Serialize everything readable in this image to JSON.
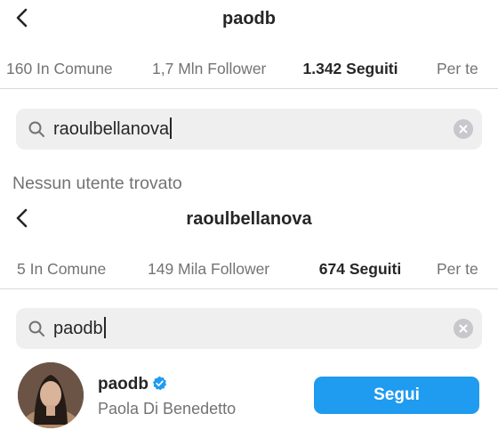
{
  "screen1": {
    "header": {
      "title": "paodb"
    },
    "tabs": [
      {
        "label": "160 In Comune",
        "active": false
      },
      {
        "label": "1,7 Mln Follower",
        "active": false
      },
      {
        "label": "1.342 Seguiti",
        "active": true
      },
      {
        "label": "Per te",
        "active": false
      }
    ],
    "search": {
      "value": "raoulbellanova"
    },
    "empty_message": "Nessun utente trovato"
  },
  "screen2": {
    "header": {
      "title": "raoulbellanova"
    },
    "tabs": [
      {
        "label": "5 In Comune",
        "active": false
      },
      {
        "label": "149 Mila Follower",
        "active": false
      },
      {
        "label": "674 Seguiti",
        "active": true
      },
      {
        "label": "Per te",
        "active": false
      }
    ],
    "search": {
      "value": "paodb"
    },
    "result": {
      "username": "paodb",
      "full_name": "Paola Di Benedetto",
      "verified": true,
      "follow_label": "Segui"
    }
  },
  "colors": {
    "accent": "#1f9bf0",
    "text_primary": "#262626",
    "text_secondary": "#737373",
    "search_bg": "#efefef"
  },
  "icons": [
    "back-arrow-icon",
    "search-icon",
    "clear-icon",
    "verified-badge-icon"
  ]
}
